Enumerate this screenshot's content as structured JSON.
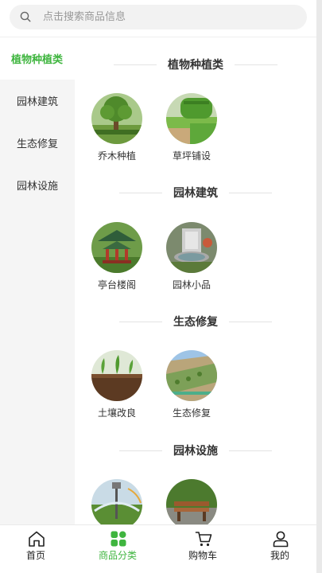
{
  "search": {
    "placeholder": "点击搜索商品信息"
  },
  "sidebar": {
    "items": [
      {
        "label": "植物种植类",
        "active": true
      },
      {
        "label": "园林建筑",
        "active": false
      },
      {
        "label": "生态修复",
        "active": false
      },
      {
        "label": "园林设施",
        "active": false
      }
    ]
  },
  "sections": [
    {
      "title": "植物种植类",
      "items": [
        {
          "label": "乔木种植"
        },
        {
          "label": "草坪铺设"
        }
      ]
    },
    {
      "title": "园林建筑",
      "items": [
        {
          "label": "亭台楼阁"
        },
        {
          "label": "园林小品"
        }
      ]
    },
    {
      "title": "生态修复",
      "items": [
        {
          "label": "土壤改良"
        },
        {
          "label": "生态修复"
        }
      ]
    },
    {
      "title": "园林设施",
      "items": [
        {
          "label": ""
        },
        {
          "label": ""
        }
      ]
    }
  ],
  "tabbar": {
    "items": [
      {
        "label": "首页",
        "icon": "home-icon"
      },
      {
        "label": "商品分类",
        "icon": "category-icon",
        "active": true
      },
      {
        "label": "购物车",
        "icon": "cart-icon"
      },
      {
        "label": "我的",
        "icon": "user-icon"
      }
    ]
  },
  "colors": {
    "accent": "#3fb53f",
    "text": "#333333",
    "sidebar_bg": "#f5f5f5"
  }
}
